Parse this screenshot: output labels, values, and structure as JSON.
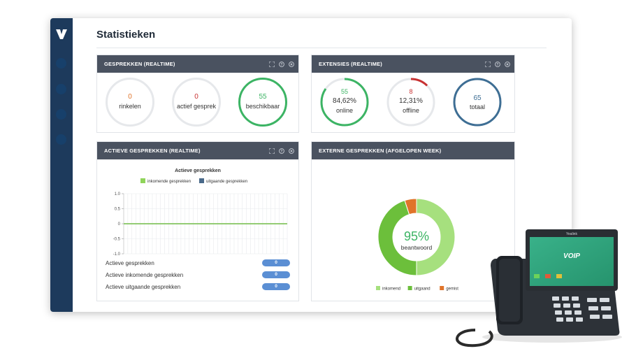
{
  "page": {
    "title": "Statistieken"
  },
  "colors": {
    "sidebar": "#1d3a5c",
    "header": "#4a5260",
    "green": "#3cb464",
    "orange": "#e0742a",
    "red": "#c83232",
    "blue": "#3e6e94",
    "light_green": "#a6e07e",
    "mid_green": "#6cbf3b",
    "badge_blue": "#5b8fd4"
  },
  "panels": {
    "realtime": {
      "title": "GESPREKKEN (REALTIME)",
      "items": [
        {
          "value": "0",
          "label": "rinkelen"
        },
        {
          "value": "0",
          "label": "actief gesprek"
        },
        {
          "value": "55",
          "label": "beschikbaar"
        }
      ]
    },
    "extensions": {
      "title": "EXTENSIES (REALTIME)",
      "items": [
        {
          "value": "55",
          "percent": "84,62%",
          "label": "online",
          "fraction": 0.8462
        },
        {
          "value": "8",
          "percent": "12,31%",
          "label": "offline",
          "fraction": 0.1231
        },
        {
          "value": "65",
          "percent": "",
          "label": "totaal",
          "fraction": 1
        }
      ]
    },
    "active": {
      "title": "ACTIEVE GESPREKKEN (REALTIME)",
      "rows": [
        {
          "label": "Actieve gesprekken",
          "value": "0"
        },
        {
          "label": "Actieve inkomende gesprekken",
          "value": "0"
        },
        {
          "label": "Actieve uitgaande gesprekken",
          "value": "0"
        }
      ]
    },
    "external": {
      "title": "EXTERNE GESPREKKEN (AFGELOPEN WEEK)",
      "center_value": "95%",
      "center_label": "beantwoord",
      "legend": [
        "inkomend",
        "uitgaand",
        "gemist"
      ]
    }
  },
  "chart_data": [
    {
      "type": "line",
      "title": "Actieve gesprekken",
      "series": [
        {
          "name": "inkomende gesprekken",
          "color": "#8fd45a",
          "values": [
            0,
            0,
            0,
            0,
            0,
            0,
            0,
            0,
            0,
            0,
            0,
            0,
            0,
            0,
            0,
            0,
            0,
            0,
            0,
            0,
            0,
            0,
            0,
            0,
            0,
            0,
            0,
            0,
            0,
            0,
            0,
            0,
            0,
            0,
            0,
            0,
            0,
            0,
            0,
            0,
            0
          ]
        },
        {
          "name": "uitgaande gesprekken",
          "color": "#4a6a8a",
          "values": [
            0,
            0,
            0,
            0,
            0,
            0,
            0,
            0,
            0,
            0,
            0,
            0,
            0,
            0,
            0,
            0,
            0,
            0,
            0,
            0,
            0,
            0,
            0,
            0,
            0,
            0,
            0,
            0,
            0,
            0,
            0,
            0,
            0,
            0,
            0,
            0,
            0,
            0,
            0,
            0,
            0
          ]
        }
      ],
      "yticks": [
        "1.0",
        "0.5",
        "0",
        "-0.5",
        "-1.0"
      ],
      "ylim": [
        -1.0,
        1.0
      ],
      "grid": true,
      "legend": "top"
    },
    {
      "type": "pie",
      "categories": [
        "inkomend",
        "uitgaand",
        "gemist"
      ],
      "values": [
        50,
        45,
        5
      ],
      "colors": [
        "#a6e07e",
        "#6cbf3b",
        "#e0742a"
      ]
    }
  ],
  "phone": {
    "brand": "Yealink",
    "screen_logo": "VOIP"
  }
}
